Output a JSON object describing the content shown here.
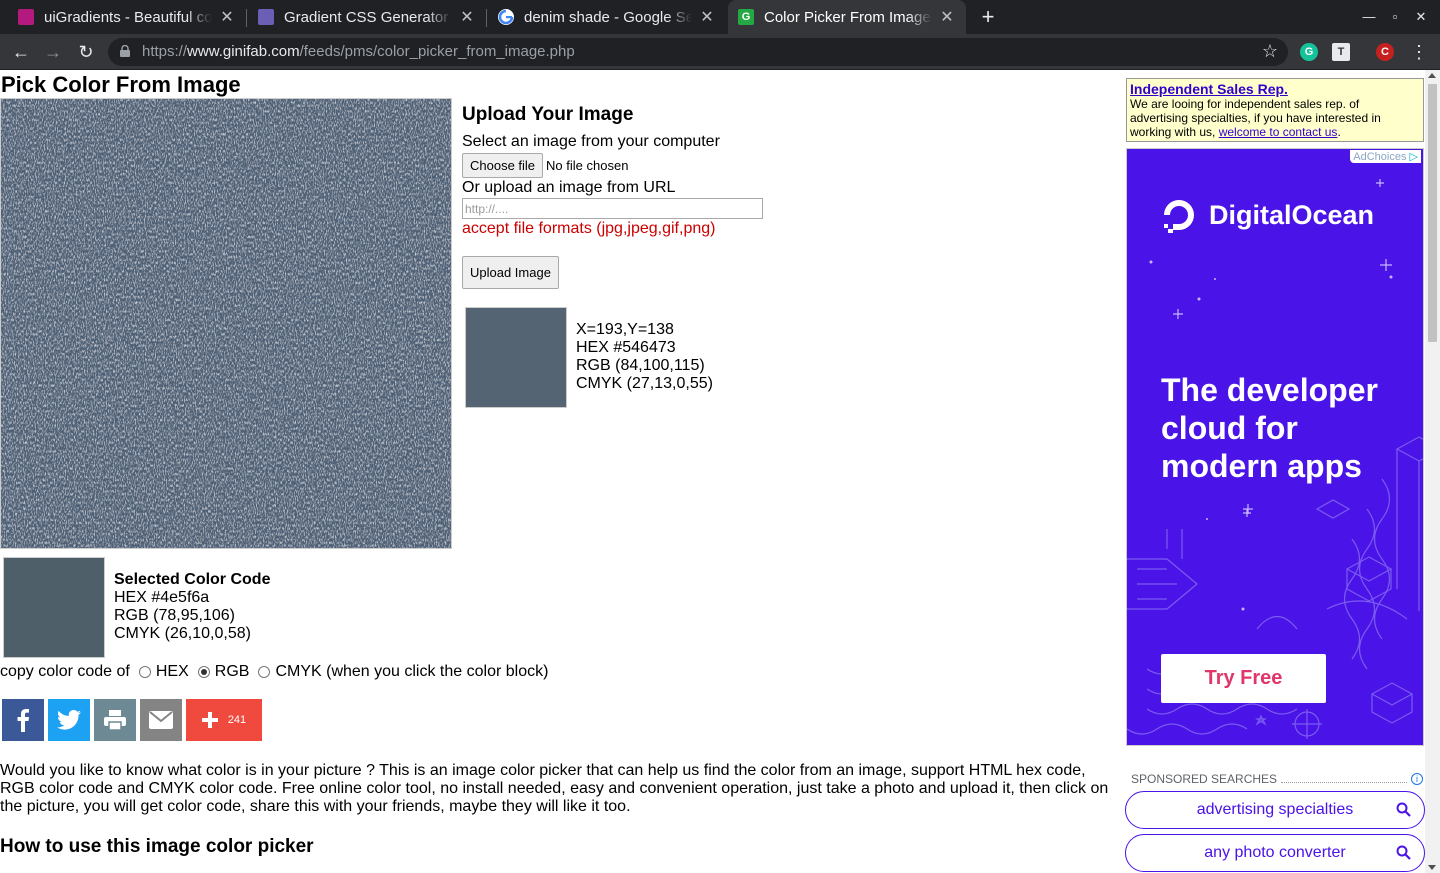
{
  "browser": {
    "tabs": [
      {
        "title": "uiGradients - Beautiful colored gradients",
        "favicon_color": "#b3197f",
        "favicon_glyph": ""
      },
      {
        "title": "Gradient CSS Generator | CSS Gradient",
        "favicon_color": "#6b5fb5",
        "favicon_glyph": ""
      },
      {
        "title": "denim shade - Google Search",
        "favicon_color": "#ffffff",
        "favicon_glyph": "G"
      },
      {
        "title": "Color Picker From Image Online",
        "favicon_color": "#23a843",
        "favicon_glyph": "G"
      }
    ],
    "url_scheme": "https://",
    "url_host": "www.ginifab.com",
    "url_path": "/feeds/pms/color_picker_from_image.php",
    "profile_initial": "C"
  },
  "page": {
    "title": "Pick Color From Image",
    "upload": {
      "heading": "Upload Your Image",
      "select_label": "Select an image from your computer",
      "choose_file": "Choose file",
      "no_file": "No file chosen",
      "url_label": "Or upload an image from URL",
      "url_placeholder": "http://....",
      "formats": "accept file formats (jpg,jpeg,gif,png)",
      "upload_button": "Upload Image"
    },
    "hover_color": {
      "hex_value": "#546473",
      "coords": "X=193,Y=138",
      "hex": "HEX #546473",
      "rgb": "RGB (84,100,115)",
      "cmyk": "CMYK (27,13,0,55)"
    },
    "selected_color": {
      "hex_value": "#4e5f6a",
      "heading": "Selected Color Code",
      "hex": "HEX #4e5f6a",
      "rgb": "RGB (78,95,106)",
      "cmyk": "CMYK (26,10,0,58)"
    },
    "copy": {
      "label": "copy color code of",
      "options": [
        "HEX",
        "RGB",
        "CMYK (when you click the color block)"
      ],
      "selected": "RGB"
    },
    "share": {
      "buttons": [
        {
          "icon": "facebook-icon",
          "color": "#3b5998"
        },
        {
          "icon": "twitter-icon",
          "color": "#1da1f2"
        },
        {
          "icon": "print-icon",
          "color": "#6d8a94"
        },
        {
          "icon": "email-icon",
          "color": "#848484"
        },
        {
          "icon": "plus-icon",
          "color": "#f0493e"
        }
      ],
      "count": "241"
    },
    "description": "Would you like to know what color is in your picture ? This is an image color picker that can help us find the color from an image, support HTML hex code, RGB color code and CMYK color code. Free online color tool, no install needed, easy and convenient operation, just take a photo and upload it, then click on the picture, you will get color code, share this with your friends, maybe they will like it too.",
    "howto_heading": "How to use this image color picker"
  },
  "sidebar": {
    "sales_ad": {
      "title": "Independent Sales Rep.",
      "body": "We are looing for independent sales rep. of advertising specialties, if you have interested in working with us, ",
      "link": "welcome to contact us",
      "end": "."
    },
    "display_ad": {
      "adchoices": "AdChoices",
      "brand": "DigitalOcean",
      "headline": "The developer cloud for modern apps",
      "cta": "Try Free",
      "bg_color": "#4a13e8",
      "cta_color": "#e0366a"
    },
    "sponsored": {
      "label": "SPONSORED SEARCHES",
      "items": [
        "advertising specialties",
        "any photo converter"
      ]
    }
  }
}
